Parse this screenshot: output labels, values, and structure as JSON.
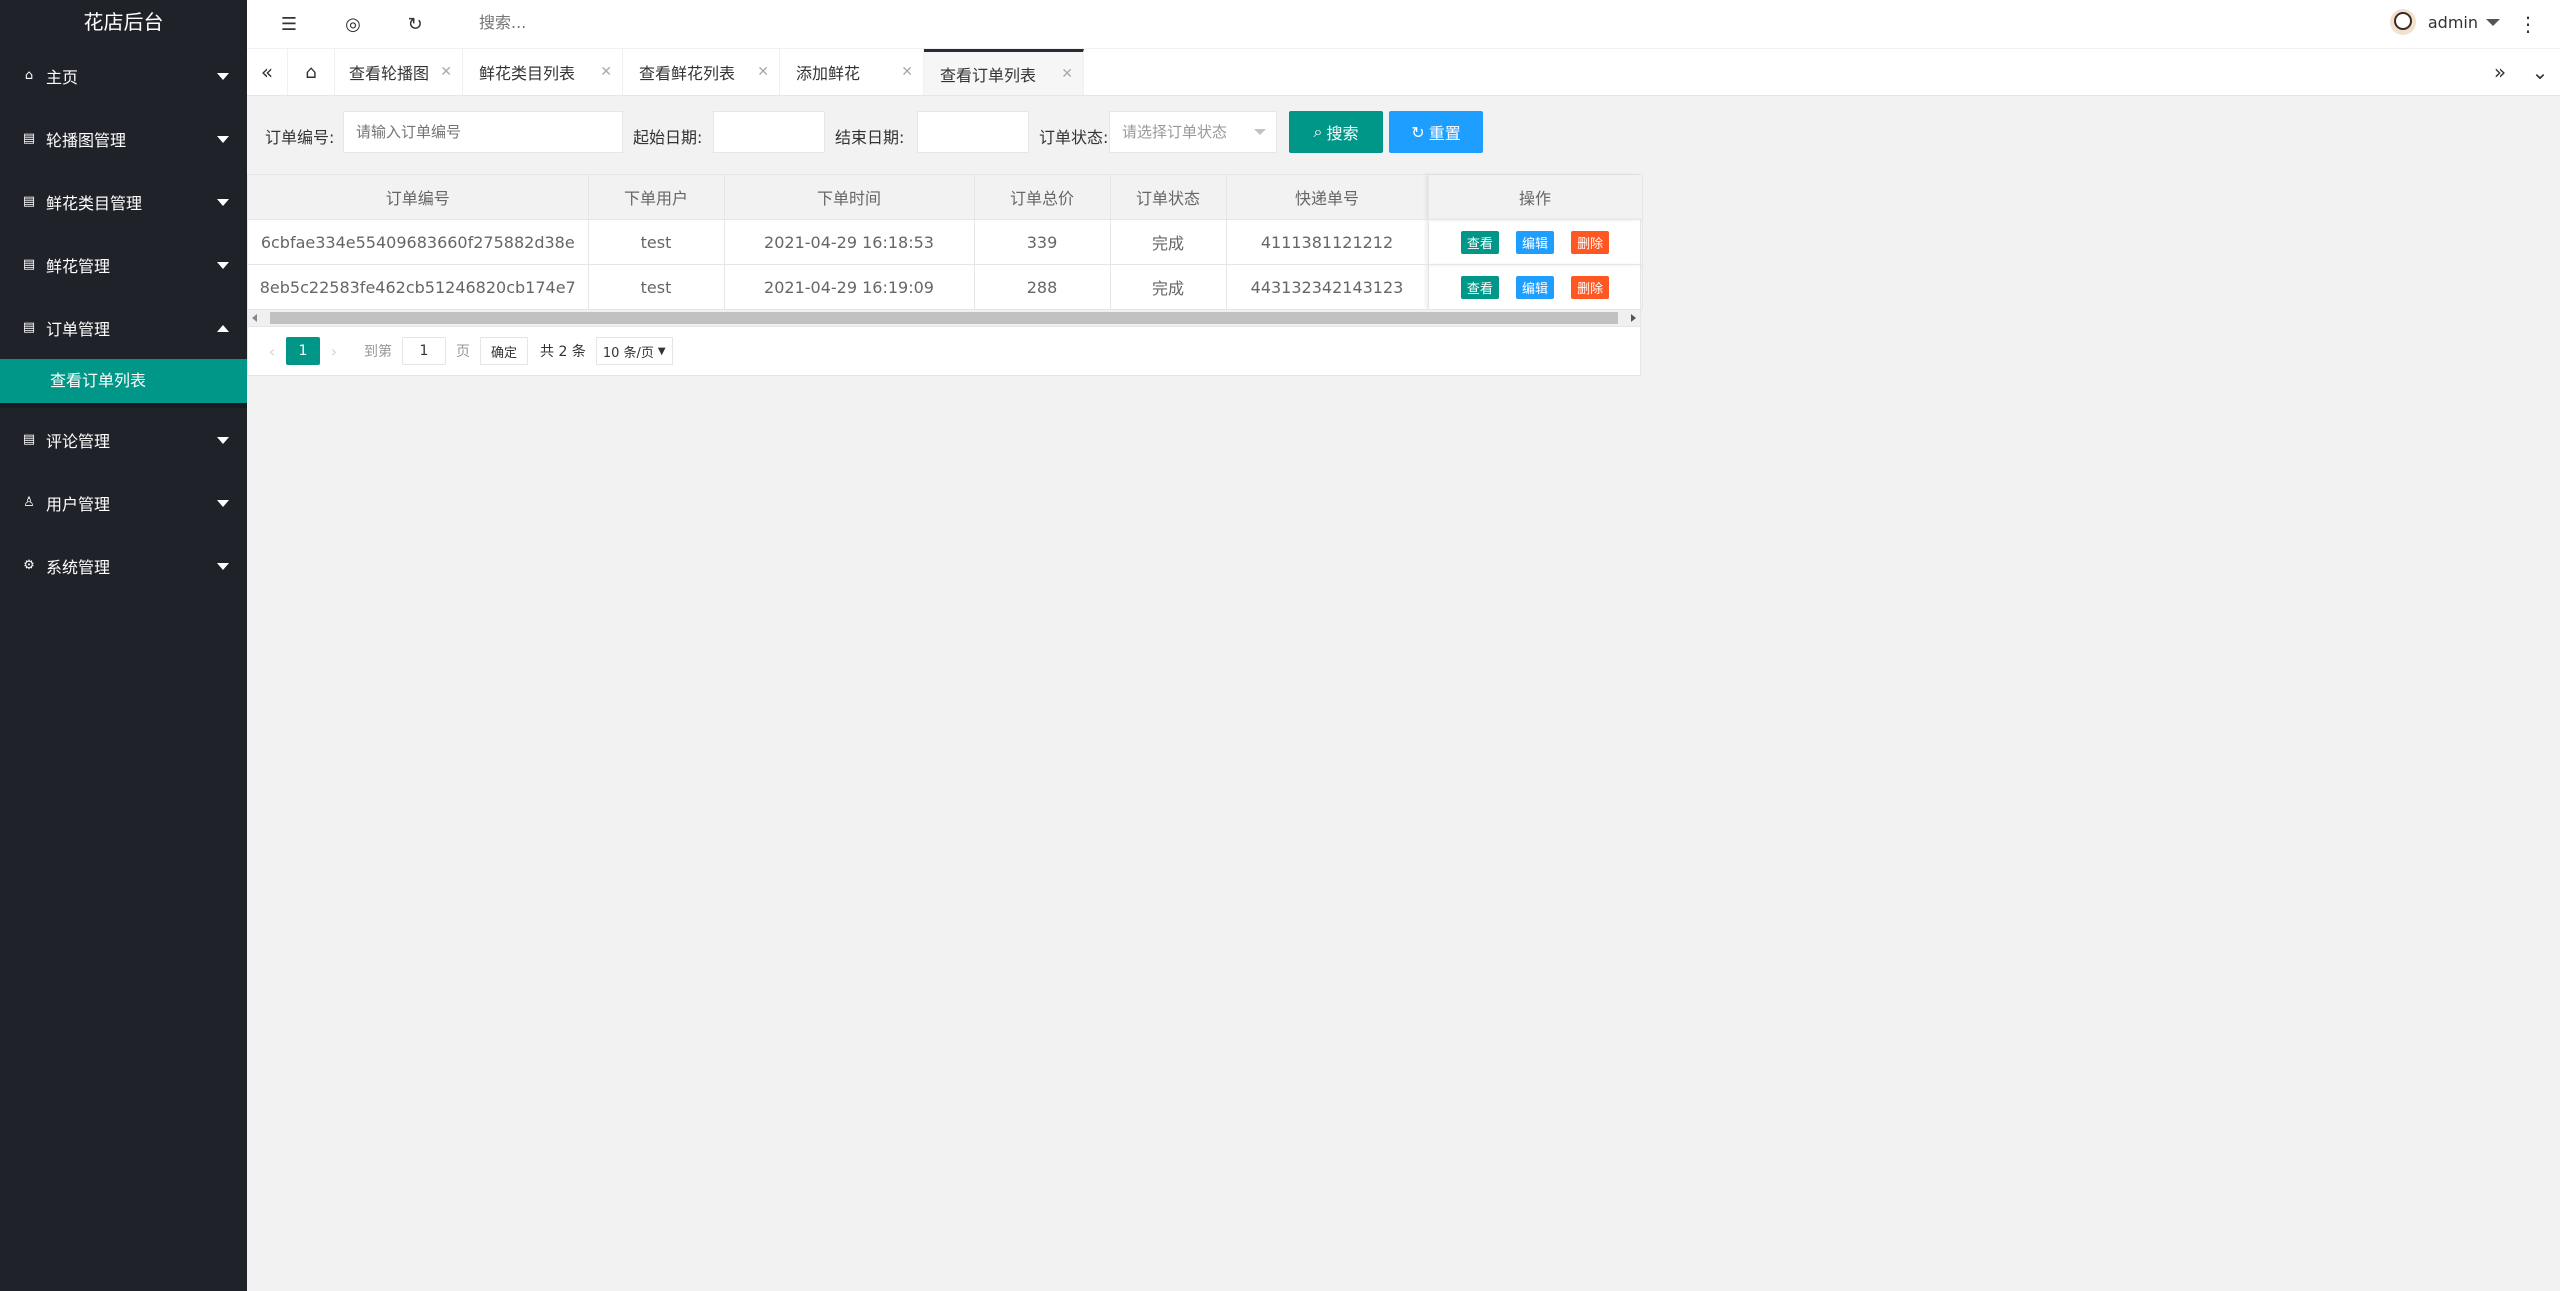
{
  "app": {
    "title": "花店后台"
  },
  "sidebar": {
    "items": [
      {
        "label": "主页",
        "icon": "home-icon",
        "expanded": false
      },
      {
        "label": "轮播图管理",
        "icon": "list-icon",
        "expanded": false
      },
      {
        "label": "鲜花类目管理",
        "icon": "list-icon",
        "expanded": false
      },
      {
        "label": "鲜花管理",
        "icon": "list-icon",
        "expanded": false
      },
      {
        "label": "订单管理",
        "icon": "list-icon",
        "expanded": true,
        "children": [
          {
            "label": "查看订单列表",
            "active": true
          }
        ]
      },
      {
        "label": "评论管理",
        "icon": "list-icon",
        "expanded": false
      },
      {
        "label": "用户管理",
        "icon": "user-icon",
        "expanded": false
      },
      {
        "label": "系统管理",
        "icon": "gear-icon",
        "expanded": false
      }
    ]
  },
  "header": {
    "search_placeholder": "搜索...",
    "user_name": "admin"
  },
  "tabs": [
    {
      "label": "查看轮播图",
      "active": false
    },
    {
      "label": "鲜花类目列表",
      "active": false
    },
    {
      "label": "查看鲜花列表",
      "active": false
    },
    {
      "label": "添加鲜花",
      "active": false
    },
    {
      "label": "查看订单列表",
      "active": true
    }
  ],
  "filter": {
    "order_no_label": "订单编号:",
    "order_no_placeholder": "请输入订单编号",
    "start_date_label": "起始日期:",
    "end_date_label": "结束日期:",
    "status_label": "订单状态:",
    "status_placeholder": "请选择订单状态",
    "search_button": "搜索",
    "reset_button": "重置"
  },
  "table": {
    "columns": [
      "订单编号",
      "下单用户",
      "下单时间",
      "订单总价",
      "订单状态",
      "快递单号",
      "操作"
    ],
    "rows": [
      [
        "6cbfae334e55409683660f275882d38e",
        "test",
        "2021-04-29 16:18:53",
        "339",
        "完成",
        "4111381121212"
      ],
      [
        "8eb5c22583fe462cb51246820cb174e7",
        "test",
        "2021-04-29 16:19:09",
        "288",
        "完成",
        "443132342143123"
      ]
    ],
    "actions": {
      "view": "查看",
      "edit": "编辑",
      "delete": "删除"
    }
  },
  "pager": {
    "current_page": "1",
    "goto_label": "到第",
    "goto_value": "1",
    "page_unit": "页",
    "confirm": "确定",
    "total": "共 2 条",
    "limit": "10 条/页"
  },
  "colors": {
    "sidebar_bg": "#20222a",
    "accent": "#009688",
    "blue": "#1e9fff",
    "danger": "#ff5722"
  }
}
